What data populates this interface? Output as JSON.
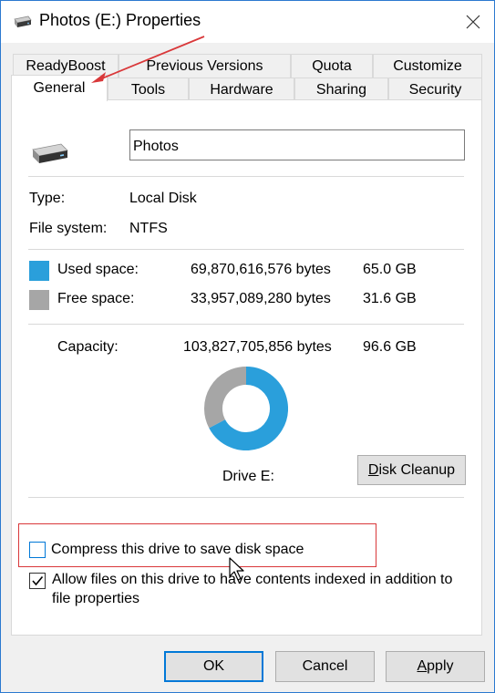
{
  "window": {
    "title": "Photos (E:) Properties"
  },
  "tabs_row1": [
    {
      "label": "ReadyBoost",
      "key": "readyboost"
    },
    {
      "label": "Previous Versions",
      "key": "previous-versions"
    },
    {
      "label": "Quota",
      "key": "quota"
    },
    {
      "label": "Customize",
      "key": "customize"
    }
  ],
  "tabs_row2": [
    {
      "label": "General",
      "key": "general",
      "active": true
    },
    {
      "label": "Tools",
      "key": "tools"
    },
    {
      "label": "Hardware",
      "key": "hardware"
    },
    {
      "label": "Sharing",
      "key": "sharing"
    },
    {
      "label": "Security",
      "key": "security"
    }
  ],
  "general": {
    "drive_name": "Photos",
    "type_label": "Type:",
    "type_value": "Local Disk",
    "fs_label": "File system:",
    "fs_value": "NTFS",
    "used_label": "Used space:",
    "used_bytes": "69,870,616,576 bytes",
    "used_gb": "65.0 GB",
    "free_label": "Free space:",
    "free_bytes": "33,957,089,280 bytes",
    "free_gb": "31.6 GB",
    "capacity_label": "Capacity:",
    "capacity_bytes": "103,827,705,856 bytes",
    "capacity_gb": "96.6 GB",
    "drive_label": "Drive E:",
    "disk_cleanup_label": "Disk Cleanup",
    "compress_label": "Compress this drive to save disk space",
    "compress_checked": false,
    "index_label_line1": "Allow files on this drive to have contents indexed in addition to",
    "index_label_line2": "file properties",
    "index_checked": true,
    "used_fraction": 0.673
  },
  "buttons": {
    "ok": "OK",
    "cancel": "Cancel",
    "apply": "Apply"
  },
  "colors": {
    "used": "#2a9fdb",
    "free": "#a6a6a6",
    "annotation": "#d9383a",
    "accent": "#0078d7"
  }
}
